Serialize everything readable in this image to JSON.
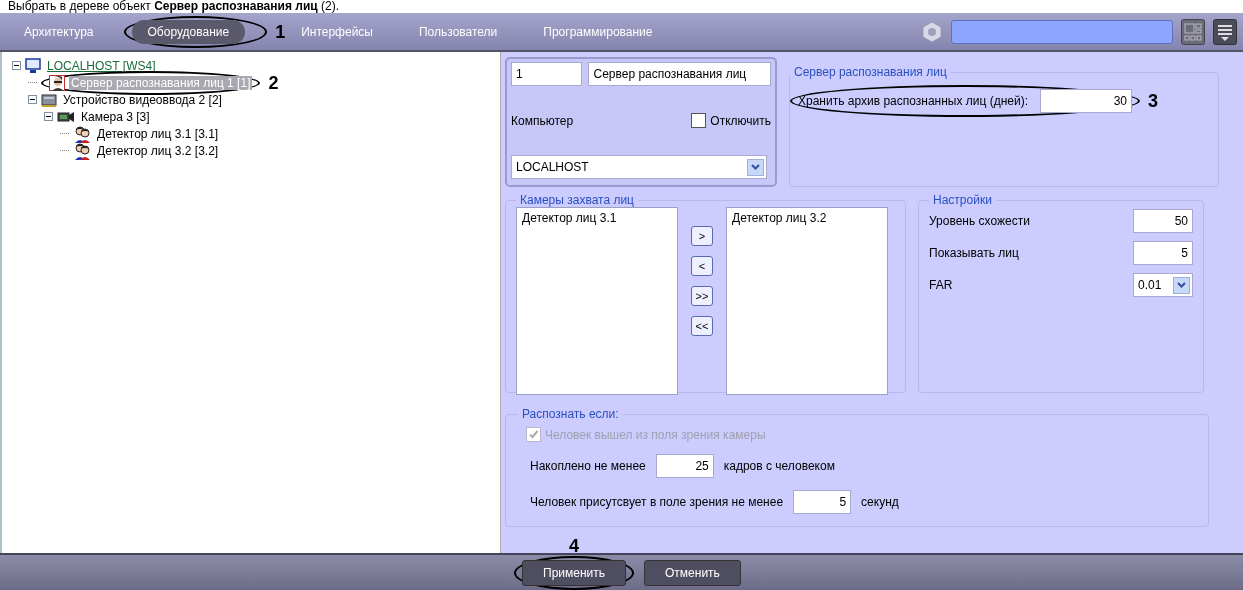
{
  "caption": "Выбрать в дереве объект **Сервер распознавания лиц** (2).",
  "tabs": [
    {
      "label": "Архитектура",
      "selected": false
    },
    {
      "label": "Оборудование",
      "selected": true,
      "annotation": "1"
    },
    {
      "label": "Интерфейсы",
      "selected": false
    },
    {
      "label": "Пользователи",
      "selected": false
    },
    {
      "label": "Программирование",
      "selected": false
    }
  ],
  "tree": [
    {
      "label": "LOCALHOST [WS4]",
      "kind": "computer",
      "expanded": true,
      "selected": false,
      "children": [
        {
          "label": "Сервер распознавания лиц 1 [1]",
          "kind": "face-server",
          "selected": true,
          "annotation": "2"
        },
        {
          "label": "Устройство видеоввода 2 [2]",
          "kind": "video-device",
          "expanded": true,
          "selected": false,
          "children": [
            {
              "label": "Камера 3 [3]",
              "kind": "camera",
              "expanded": true,
              "selected": false,
              "children": [
                {
                  "label": "Детектор лиц 3.1 [3.1]",
                  "kind": "face-detector",
                  "selected": false
                },
                {
                  "label": "Детектор лиц 3.2 [3.2]",
                  "kind": "face-detector",
                  "selected": false
                }
              ]
            }
          ]
        }
      ]
    }
  ],
  "object": {
    "id": "1",
    "name": "Сервер распознавания лиц",
    "computer_label": "Компьютер",
    "disable": {
      "label": "Отключить",
      "checked": false
    },
    "computer": "LOCALHOST"
  },
  "server_group": {
    "title": "Сервер распознавания лиц",
    "archive_label": "Хранить архив распознанных лиц (дней):",
    "archive_days": "30",
    "annotation": "3"
  },
  "cameras_group": {
    "title": "Камеры захвата лиц",
    "available": [
      "Детектор лиц 3.1"
    ],
    "chosen": [
      "Детектор лиц 3.2"
    ],
    "buttons": [
      ">",
      "<",
      ">>",
      "<<"
    ]
  },
  "settings_group": {
    "title": "Настройки",
    "rows": [
      {
        "label": "Уровень схожести",
        "value": "50",
        "kind": "input"
      },
      {
        "label": "Показывать лиц",
        "value": "5",
        "kind": "input"
      },
      {
        "label": "FAR",
        "value": "0.01",
        "kind": "select"
      }
    ]
  },
  "recognize_group": {
    "title": "Распознать если:",
    "left_view": {
      "label": "Человек вышел из поля зрения камеры",
      "checked": true,
      "disabled": true
    },
    "frames": {
      "label": "Накоплено не менее",
      "value": "25",
      "unit": "кадров с человеком"
    },
    "presence": {
      "label": "Человек присутсвует в поле зрения не менее",
      "value": "5",
      "unit": "секунд"
    }
  },
  "buttons": [
    {
      "label": "Применить",
      "annotation": "4"
    },
    {
      "label": "Отменить"
    }
  ]
}
